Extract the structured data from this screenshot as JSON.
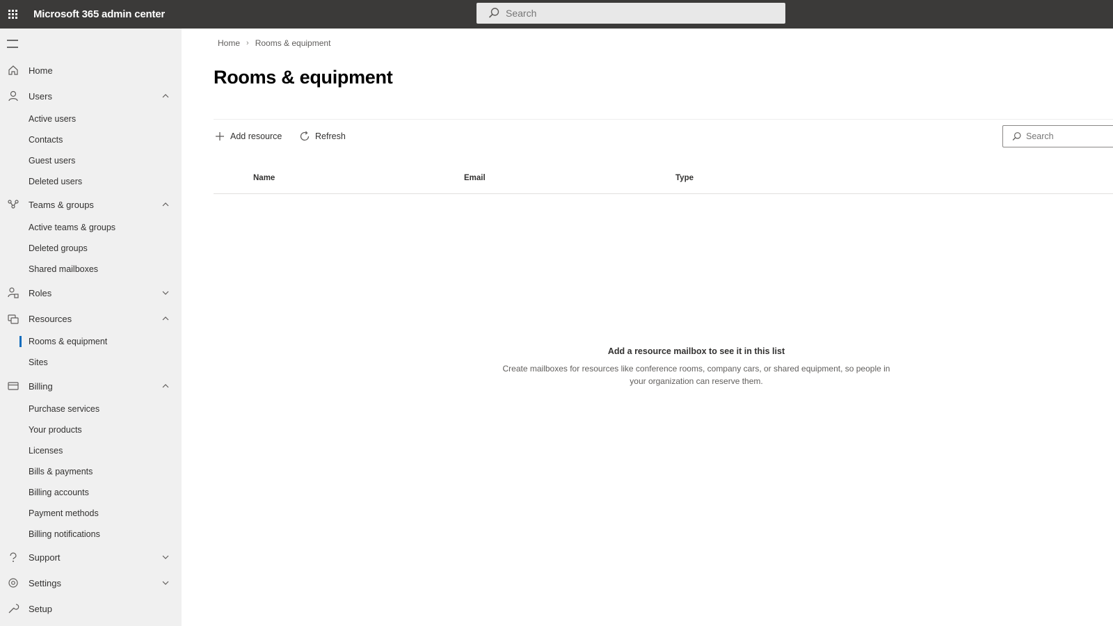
{
  "topbar": {
    "app_title": "Microsoft 365 admin center",
    "search_placeholder": "Search",
    "background": "#3b3a39"
  },
  "sidebar": {
    "background": "#f0f0f0",
    "accent": "#0f6cbd",
    "items": [
      {
        "label": "Home",
        "icon": "home-icon"
      },
      {
        "label": "Users",
        "icon": "user-icon",
        "expanded": true,
        "children": [
          "Active users",
          "Contacts",
          "Guest users",
          "Deleted users"
        ]
      },
      {
        "label": "Teams & groups",
        "icon": "groups-icon",
        "expanded": true,
        "children": [
          "Active teams & groups",
          "Deleted groups",
          "Shared mailboxes"
        ]
      },
      {
        "label": "Roles",
        "icon": "roles-icon",
        "expanded": false
      },
      {
        "label": "Resources",
        "icon": "resources-icon",
        "expanded": true,
        "children": [
          "Rooms & equipment",
          "Sites"
        ],
        "active_child": "Rooms & equipment"
      },
      {
        "label": "Billing",
        "icon": "billing-icon",
        "expanded": true,
        "children": [
          "Purchase services",
          "Your products",
          "Licenses",
          "Bills & payments",
          "Billing accounts",
          "Payment methods",
          "Billing notifications"
        ]
      },
      {
        "label": "Support",
        "icon": "support-icon",
        "expanded": false
      },
      {
        "label": "Settings",
        "icon": "gear-icon",
        "expanded": false
      },
      {
        "label": "Setup",
        "icon": "setup-icon"
      }
    ]
  },
  "breadcrumb": {
    "home": "Home",
    "current": "Rooms & equipment"
  },
  "page": {
    "title": "Rooms & equipment"
  },
  "commands": {
    "add_resource": "Add resource",
    "refresh": "Refresh",
    "search_placeholder": "Search"
  },
  "table": {
    "columns": [
      "Name",
      "Email",
      "Type"
    ],
    "rows": []
  },
  "empty_state": {
    "title": "Add a resource mailbox to see it in this list",
    "description": "Create mailboxes for resources like conference rooms, company cars, or shared equipment, so people in your organization can reserve them."
  }
}
